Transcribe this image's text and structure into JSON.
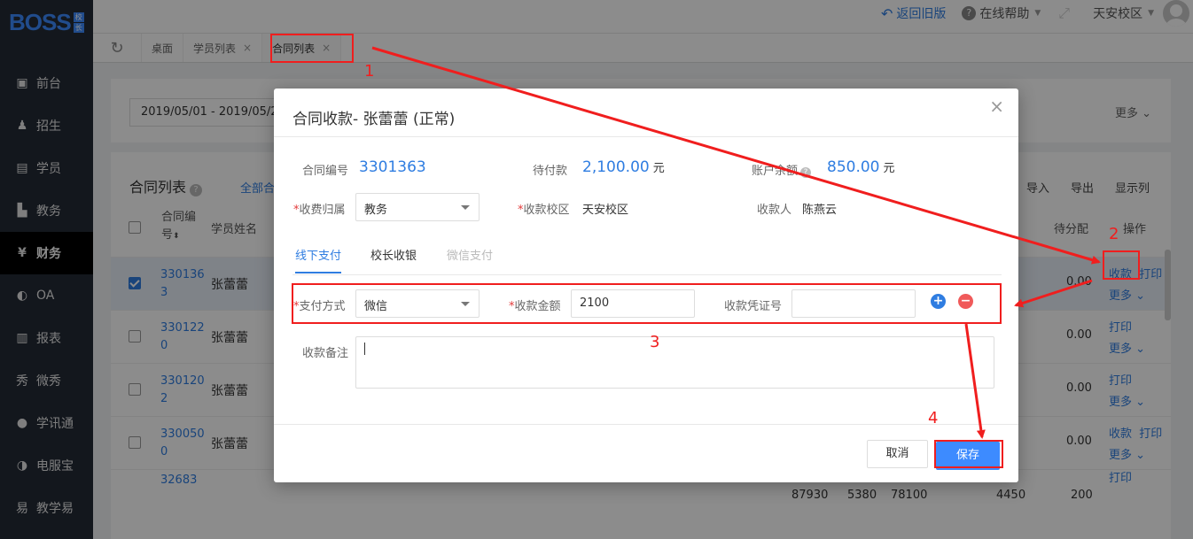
{
  "app": {
    "logo_text": "BOSS",
    "logo_badge": [
      "校",
      "长"
    ]
  },
  "topbar": {
    "back_old": "返回旧版",
    "help": "在线帮助",
    "campus": "天安校区"
  },
  "sidebar": {
    "items": [
      {
        "label": "前台",
        "icon": "calendar-icon"
      },
      {
        "label": "招生",
        "icon": "user-add-icon"
      },
      {
        "label": "学员",
        "icon": "id-card-icon"
      },
      {
        "label": "教务",
        "icon": "book-icon"
      },
      {
        "label": "财务",
        "icon": "yen-icon"
      },
      {
        "label": "OA",
        "icon": "oa-icon"
      },
      {
        "label": "报表",
        "icon": "bar-chart-icon"
      },
      {
        "label": "微秀",
        "icon": "wei-icon"
      },
      {
        "label": "学讯通",
        "icon": "location-icon"
      },
      {
        "label": "电服宝",
        "icon": "phone-icon"
      },
      {
        "label": "教学易",
        "icon": "teach-icon"
      }
    ],
    "active_index": 4
  },
  "tabs": {
    "items": [
      "桌面",
      "学员列表",
      "合同列表"
    ],
    "close": "×"
  },
  "filters": {
    "date_range": "2019/05/01 - 2019/05/2",
    "more": "更多"
  },
  "list": {
    "title": "合同列表",
    "all_tab": "全部合",
    "actions": [
      "导入",
      "导出",
      "显示列"
    ],
    "headers": {
      "contract_no": "合同编号",
      "student_name": "学员姓名",
      "to_allocate": "待分配",
      "ops": "操作"
    },
    "rows": [
      {
        "no": "3301363",
        "name": "张蕾蕾",
        "amount": "0.00",
        "ops": [
          "收款",
          "打印"
        ],
        "more": "更多",
        "selected": true
      },
      {
        "no": "3301220",
        "name": "张蕾蕾",
        "amount": "0.00",
        "ops": [
          "打印"
        ],
        "more": "更多",
        "selected": false
      },
      {
        "no": "3301202",
        "name": "张蕾蕾",
        "amount": "0.00",
        "ops": [
          "打印"
        ],
        "more": "更多",
        "selected": false
      },
      {
        "no": "3300500",
        "name": "张蕾蕾",
        "amount": "0.00",
        "ops": [
          "收款",
          "打印"
        ],
        "more": "更多",
        "selected": false
      },
      {
        "no": "32683",
        "name": "",
        "amount": "",
        "ops": [
          "打印"
        ],
        "more": "",
        "selected": false
      }
    ],
    "totals": [
      "87930",
      "5380",
      "78100",
      "4450",
      "200"
    ]
  },
  "modal": {
    "title": "合同收款- 张蕾蕾 (正常)",
    "contract_label": "合同编号",
    "contract_no": "3301363",
    "pending_label": "待付款",
    "pending_amount": "2,100.00",
    "unit": "元",
    "balance_label_a": "账户",
    "balance_label_b": "余额",
    "balance_amount": "850.00",
    "fee_owner_label": "收费归属",
    "fee_owner_value": "教务",
    "campus_label": "收款校区",
    "campus_value": "天安校区",
    "payee_label": "收款人",
    "payee_value": "陈燕云",
    "pay_tabs": [
      "线下支付",
      "校长收银",
      "微信支付"
    ],
    "method_label": "支付方式",
    "method_value": "微信",
    "amount_label": "收款金额",
    "amount_value": "2100",
    "voucher_label": "收款凭证号",
    "voucher_value": "",
    "note_label": "收款备注",
    "note_value": "",
    "cancel": "取消",
    "save": "保存",
    "close": "×"
  },
  "annotations": {
    "numbers": [
      "1",
      "2",
      "3",
      "4"
    ],
    "color": "#f01e1e"
  }
}
